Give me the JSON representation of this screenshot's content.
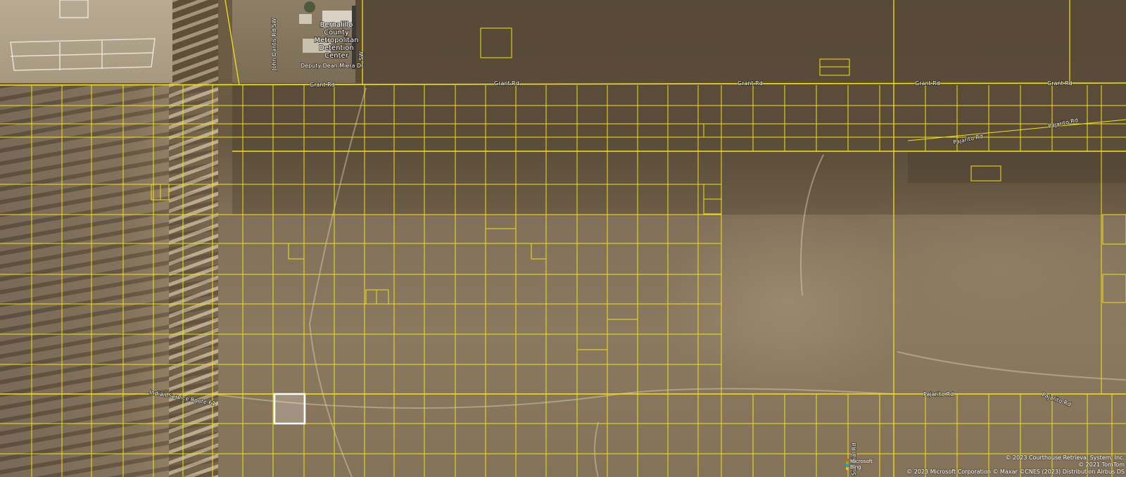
{
  "map": {
    "colors": {
      "parcel_line": "#f2e313",
      "selected_parcel": "#ffffff",
      "road_label": "#ffffff"
    },
    "poi": {
      "name_lines": [
        "Bernalillo",
        "County",
        "Metropolitan",
        "Detention",
        "Center"
      ]
    },
    "roads": {
      "grant_rd": "Grant Rd",
      "pajarito_rd": "Pajarito Rd",
      "john_dantis_rd": "John Dantis Rd SW",
      "deputy_dean_miera": "Deputy Dean Miera Dr",
      "sw_label": "SW",
      "indian_service_route": "Indian Service Route 61",
      "sun_dial_rd": "Sun Dial Rd"
    },
    "attribution": {
      "line1": "© 2023 Courthouse Retrieval System, Inc.",
      "line2": "© 2021 TomTom",
      "line3": "© 2023 Microsoft Corporation © Maxar ©CNES (2023) Distribution Airbus DS"
    },
    "logo": {
      "line1": "Microsoft",
      "line2": "Bing"
    }
  }
}
